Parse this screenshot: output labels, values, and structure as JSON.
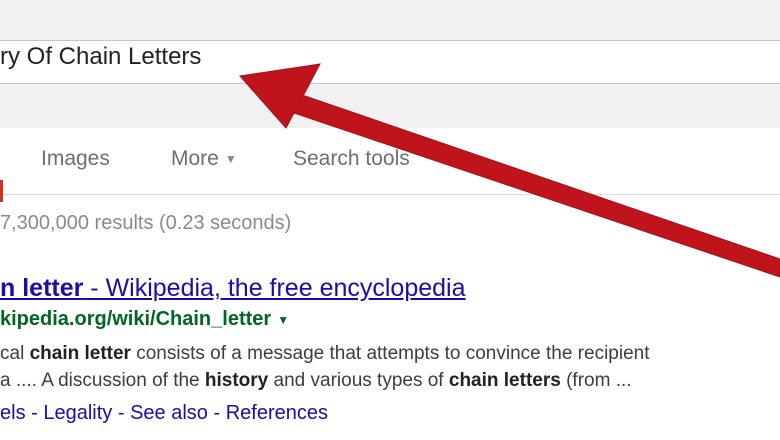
{
  "search": {
    "query": "ry Of Chain Letters"
  },
  "tabs": [
    {
      "label": "Images"
    },
    {
      "label": "More",
      "has_dropdown": true
    },
    {
      "label": "Search tools"
    }
  ],
  "stats": "7,300,000 results (0.23 seconds)",
  "result": {
    "title_pre": "n letter",
    "title_post": " - Wikipedia, the free encyclopedia",
    "url": "kipedia.org/wiki/Chain_letter",
    "snippet_line1": [
      {
        "text": "cal ",
        "bold": false
      },
      {
        "text": "chain letter",
        "bold": true
      },
      {
        "text": " consists of a message that attempts to convince the recipient",
        "bold": false
      }
    ],
    "snippet_line2": [
      {
        "text": "a .... A discussion of the ",
        "bold": false
      },
      {
        "text": "history",
        "bold": true
      },
      {
        "text": " and various types of ",
        "bold": false
      },
      {
        "text": "chain letters",
        "bold": true
      },
      {
        "text": " (from ...",
        "bold": false
      }
    ],
    "sitelinks": [
      "els",
      "Legality",
      "See also",
      "References"
    ]
  },
  "colors": {
    "link": "#1a0dab",
    "url_green": "#006621",
    "arrow_red": "#c0141d"
  }
}
